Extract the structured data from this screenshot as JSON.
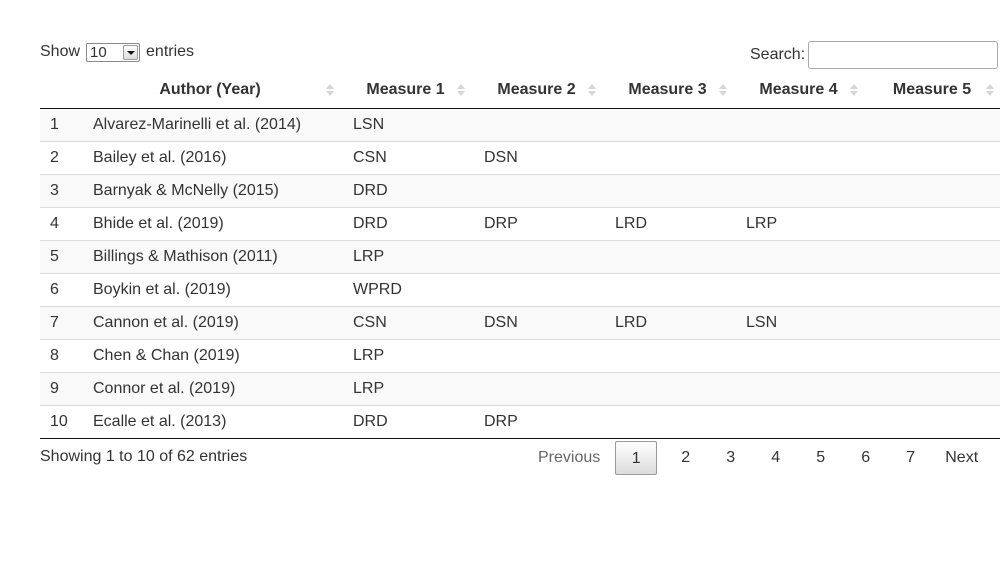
{
  "length": {
    "label_before": "Show",
    "value": "10",
    "label_after": "entries"
  },
  "search": {
    "label": "Search:",
    "value": ""
  },
  "headers": [
    "Author (Year)",
    "Measure 1",
    "Measure 2",
    "Measure 3",
    "Measure 4",
    "Measure 5"
  ],
  "rows": [
    [
      "1",
      "Alvarez-Marinelli et al. (2014)",
      "LSN",
      "",
      "",
      "",
      ""
    ],
    [
      "2",
      "Bailey et al. (2016)",
      "CSN",
      "DSN",
      "",
      "",
      ""
    ],
    [
      "3",
      "Barnyak & McNelly (2015)",
      "DRD",
      "",
      "",
      "",
      ""
    ],
    [
      "4",
      "Bhide et al. (2019)",
      "DRD",
      "DRP",
      "LRD",
      "LRP",
      ""
    ],
    [
      "5",
      "Billings & Mathison (2011)",
      "LRP",
      "",
      "",
      "",
      ""
    ],
    [
      "6",
      "Boykin et al. (2019)",
      "WPRD",
      "",
      "",
      "",
      ""
    ],
    [
      "7",
      "Cannon et al. (2019)",
      "CSN",
      "DSN",
      "LRD",
      "LSN",
      ""
    ],
    [
      "8",
      "Chen & Chan (2019)",
      "LRP",
      "",
      "",
      "",
      ""
    ],
    [
      "9",
      "Connor et al. (2019)",
      "LRP",
      "",
      "",
      "",
      ""
    ],
    [
      "10",
      "Ecalle et al. (2013)",
      "DRD",
      "DRP",
      "",
      "",
      ""
    ]
  ],
  "info": "Showing 1 to 10 of 62 entries",
  "pagination": {
    "previous": "Previous",
    "pages": [
      "1",
      "2",
      "3",
      "4",
      "5",
      "6",
      "7"
    ],
    "current": "1",
    "next": "Next"
  }
}
